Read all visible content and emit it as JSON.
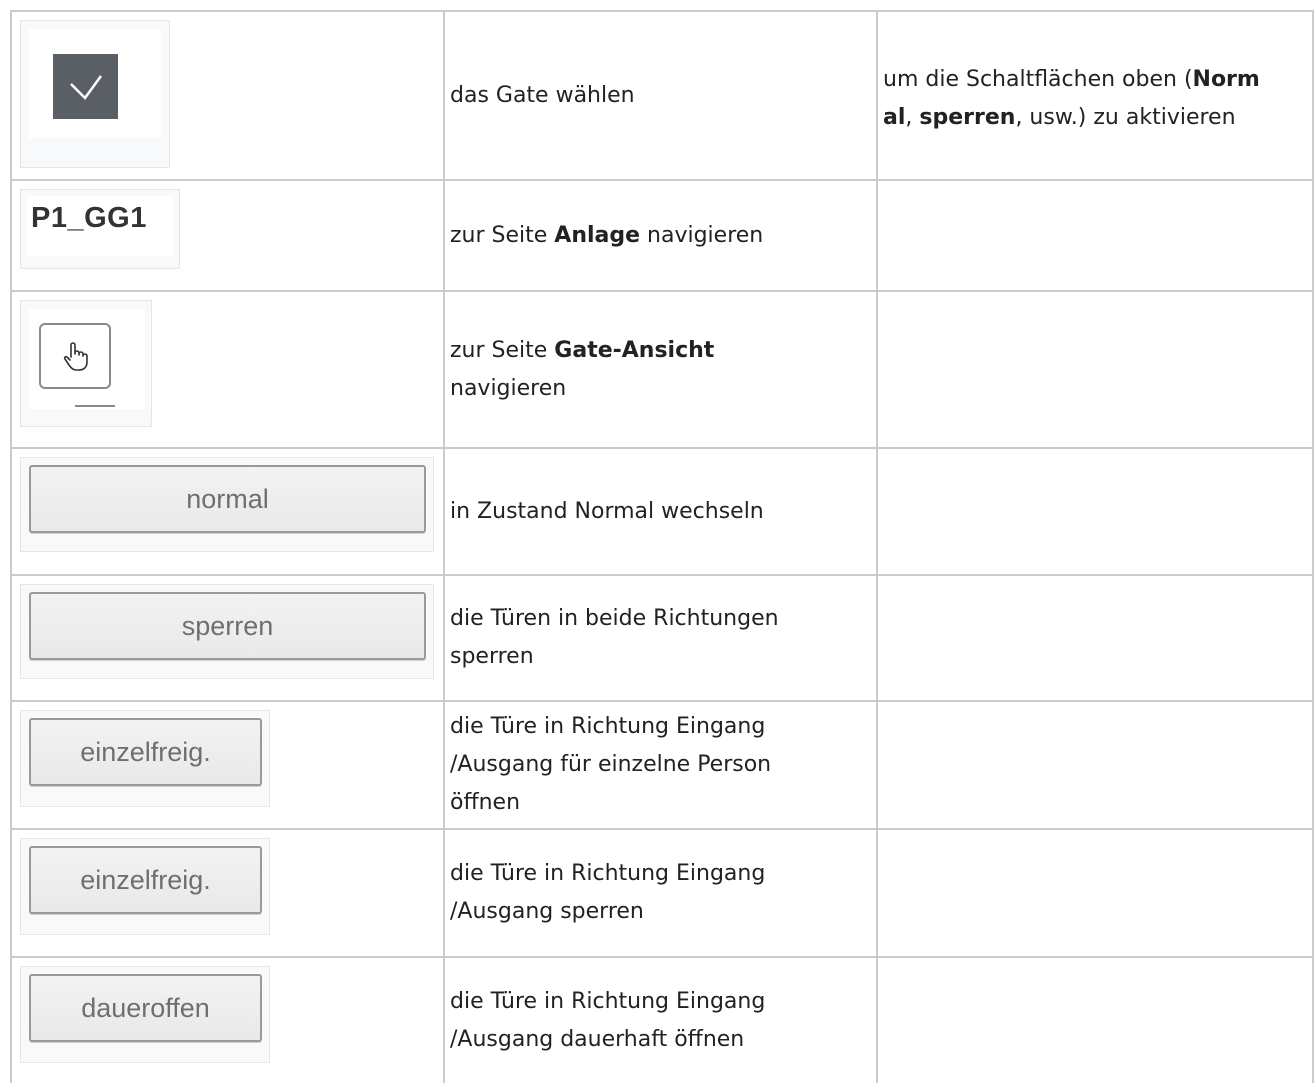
{
  "rows": [
    {
      "image": {
        "kind": "checkbox",
        "icon": "checkmark-icon",
        "color": "#5a5f66"
      },
      "action": "das Gate wählen",
      "note": {
        "prefix": "um die Schaltflächen oben (",
        "bold1": "Norm al",
        "sep": ", ",
        "bold2": "sperren",
        "suffix": ", usw.) zu aktivieren"
      }
    },
    {
      "image": {
        "kind": "label",
        "text": "P1_GG1"
      },
      "action": {
        "prefix": "zur Seite ",
        "bold": "Anlage",
        "suffix": " navigieren"
      },
      "note": ""
    },
    {
      "image": {
        "kind": "button",
        "icon": "hand-pointer-icon"
      },
      "action": {
        "prefix": "zur Seite ",
        "bold": "Gate-Ansicht",
        "suffix": "navigieren"
      },
      "note": ""
    },
    {
      "image": {
        "kind": "button",
        "text": "normal"
      },
      "action": "in Zustand Normal wechseln",
      "note": ""
    },
    {
      "image": {
        "kind": "button",
        "text": "sperren"
      },
      "action": {
        "line1": "die Türen in beide Richtungen",
        "line2": "sperren"
      },
      "note": ""
    },
    {
      "image": {
        "kind": "button",
        "text": "einzelfreig."
      },
      "action": {
        "line1": "die Türe in Richtung Eingang",
        "line2": "/Ausgang für einzelne Person",
        "line3": "öffnen"
      },
      "note": ""
    },
    {
      "image": {
        "kind": "button",
        "text": "einzelfreig."
      },
      "action": {
        "line1": "die Türe in Richtung Eingang",
        "line2": "/Ausgang sperren"
      },
      "note": ""
    },
    {
      "image": {
        "kind": "button",
        "text": "daueroffen"
      },
      "action": {
        "line1": "die Türe in Richtung Eingang",
        "line2": "/Ausgang dauerhaft öffnen"
      },
      "note": ""
    }
  ]
}
